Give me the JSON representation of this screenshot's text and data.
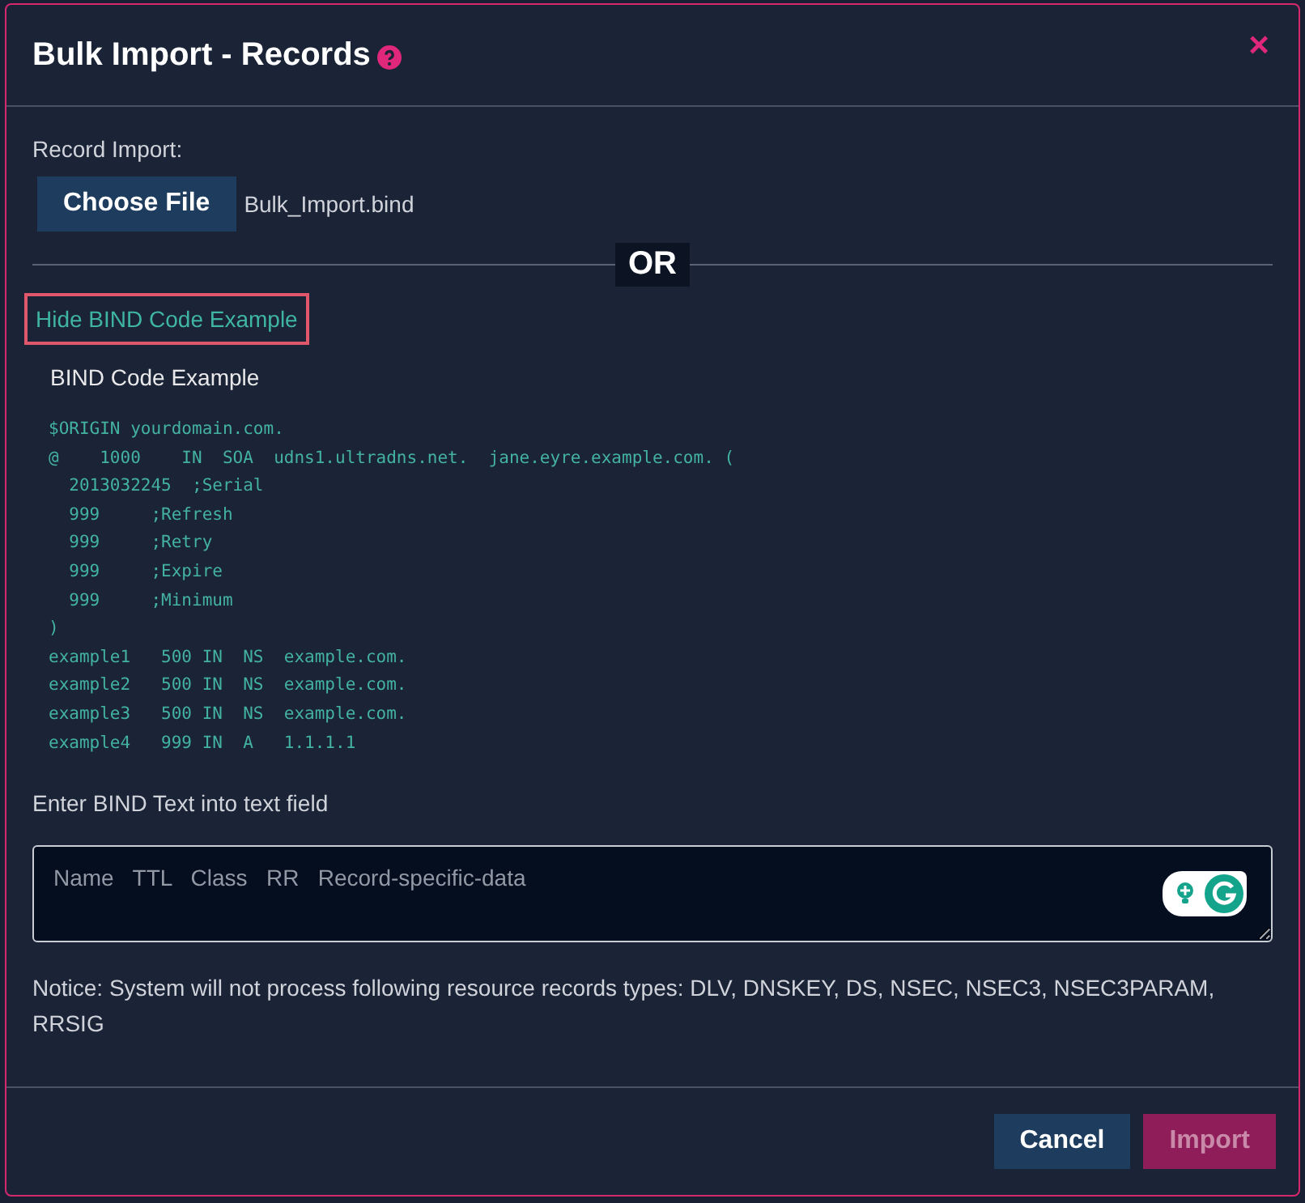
{
  "dialog": {
    "title": "Bulk Import - Records",
    "close": "×"
  },
  "record_import": {
    "label": "Record Import:",
    "button": "Choose File",
    "file_name": "Bulk_Import.bind"
  },
  "divider_text": "OR",
  "toggle_link": {
    "label": "Hide BIND Code Example",
    "focused": true
  },
  "example": {
    "heading": "BIND Code Example",
    "lines": [
      "$ORIGIN yourdomain.com.",
      "@    1000    IN  SOA  udns1.ultradns.net.  jane.eyre.example.com. (",
      "  2013032245  ;Serial",
      "  999     ;Refresh",
      "  999     ;Retry",
      "  999     ;Expire",
      "  999     ;Minimum",
      ")",
      "example1   500 IN  NS  example.com.",
      "example2   500 IN  NS  example.com.",
      "example3   500 IN  NS  example.com.",
      "example4   999 IN  A   1.1.1.1"
    ]
  },
  "text_field": {
    "label": "Enter BIND Text into text field",
    "placeholder": "Name   TTL   Class   RR   Record-specific-data"
  },
  "notice": "Notice: System will not process following resource records types: DLV, DNSKEY, DS, NSEC, NSEC3, NSEC3PARAM, RRSIG",
  "buttons": [
    {
      "label": "Cancel",
      "kind": "secondary",
      "disabled": false
    },
    {
      "label": "Import",
      "kind": "primary",
      "disabled": true
    }
  ]
}
